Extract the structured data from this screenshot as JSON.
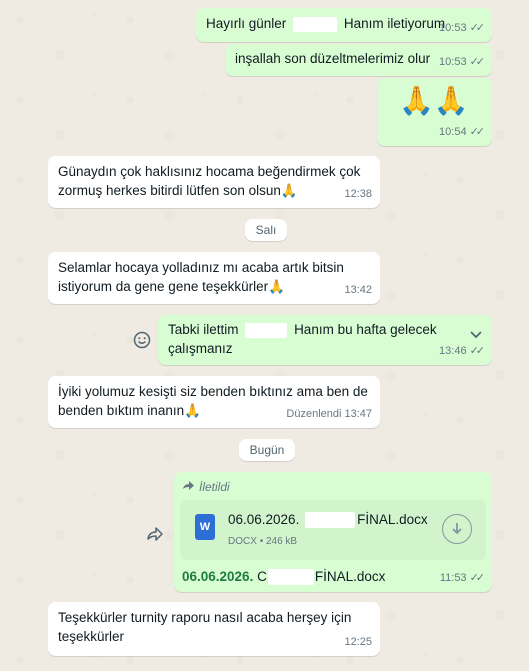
{
  "messages": [
    {
      "id": "m1",
      "dir": "out",
      "text_a": "Hayırlı günler",
      "text_b": "Hanım iletiyorum",
      "time": "10:53",
      "ticks": "✓✓"
    },
    {
      "id": "m2",
      "dir": "out",
      "text": "inşallah son düzeltmelerimiz olur",
      "time": "10:53",
      "ticks": "✓✓"
    },
    {
      "id": "m3",
      "dir": "out",
      "text": "🙏🙏",
      "time": "10:54",
      "ticks": "✓✓"
    },
    {
      "id": "m4",
      "dir": "in",
      "line1": "Günaydın çok haklısınız hocama beğendirmek çok",
      "line2": "zormuş herkes bitirdi lütfen son olsun🙏",
      "time": "12:38"
    },
    {
      "id": "m5",
      "dir": "in",
      "line1": "Selamlar hocaya yolladınız mı acaba artık bitsin",
      "line2": "istiyorum da gene gene teşekkürler🙏",
      "time": "13:42"
    },
    {
      "id": "m6",
      "dir": "out",
      "line1_a": "Tabki ilettim",
      "line1_b": "Hanım bu hafta gelecek",
      "line2": "çalışmanız",
      "time": "13:46",
      "ticks": "✓✓"
    },
    {
      "id": "m7",
      "dir": "in",
      "line1": "İyiki yolumuz kesişti siz benden bıktınız ama ben de",
      "line2": "benden bıktım inanın🙏",
      "edited": "Düzenlendi",
      "time": "13:47"
    },
    {
      "id": "m8",
      "dir": "out",
      "forwarded": "İletildi",
      "file_name_a": "06.06.2026.",
      "file_name_b": "FİNAL.docx",
      "file_type": "DOCX",
      "file_size": "246 kB",
      "caption_a": "06.06.2026.",
      "caption_b": "C",
      "caption_c": "FİNAL.docx",
      "time": "11:53",
      "ticks": "✓✓"
    },
    {
      "id": "m9",
      "dir": "in",
      "line1": "Teşekkürler turnity raporu nasıl acaba herşey için",
      "line2": "teşekkürler",
      "time": "12:25"
    }
  ],
  "separators": {
    "day1": "Salı",
    "day2": "Bugün"
  },
  "icons": {
    "react": "smiley-icon",
    "forward": "forward-icon",
    "chevron": "chevron-down-icon",
    "download": "download-icon",
    "word": "word-doc-icon"
  },
  "colors": {
    "outgoing": "#d9fdd3",
    "incoming": "#ffffff",
    "background": "#efeae2",
    "caption_green": "#1f7a45"
  }
}
